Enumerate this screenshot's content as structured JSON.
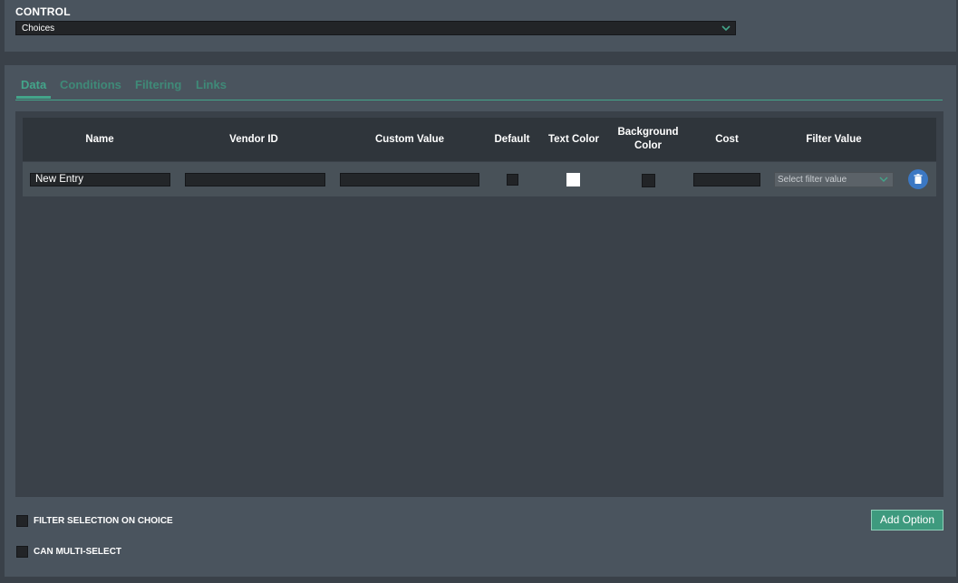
{
  "control": {
    "label": "CONTROL",
    "selected": "Choices",
    "chevron_icon": "chevron-down-icon"
  },
  "tabs": [
    {
      "label": "Data",
      "active": true
    },
    {
      "label": "Conditions",
      "active": false
    },
    {
      "label": "Filtering",
      "active": false
    },
    {
      "label": "Links",
      "active": false
    }
  ],
  "table": {
    "columns": [
      "Name",
      "Vendor ID",
      "Custom Value",
      "Default",
      "Text Color",
      "Background Color",
      "Cost",
      "Filter Value"
    ],
    "rows": [
      {
        "name": "New Entry",
        "vendor_id": "",
        "custom_value": "",
        "default": false,
        "text_color": "#ffffff",
        "background_color": "#222427",
        "cost": "",
        "filter_placeholder": "Select filter value",
        "delete_icon": "trash-icon"
      }
    ]
  },
  "options": {
    "filter_selection": {
      "label": "FILTER SELECTION ON CHOICE",
      "checked": false
    },
    "multi_select": {
      "label": "CAN MULTI-SELECT",
      "checked": false
    }
  },
  "add_option_label": "Add Option",
  "colors": {
    "accent": "#43a58a",
    "panel": "#4a545e",
    "background": "#3a4149",
    "delete_button": "#3b78c4"
  }
}
